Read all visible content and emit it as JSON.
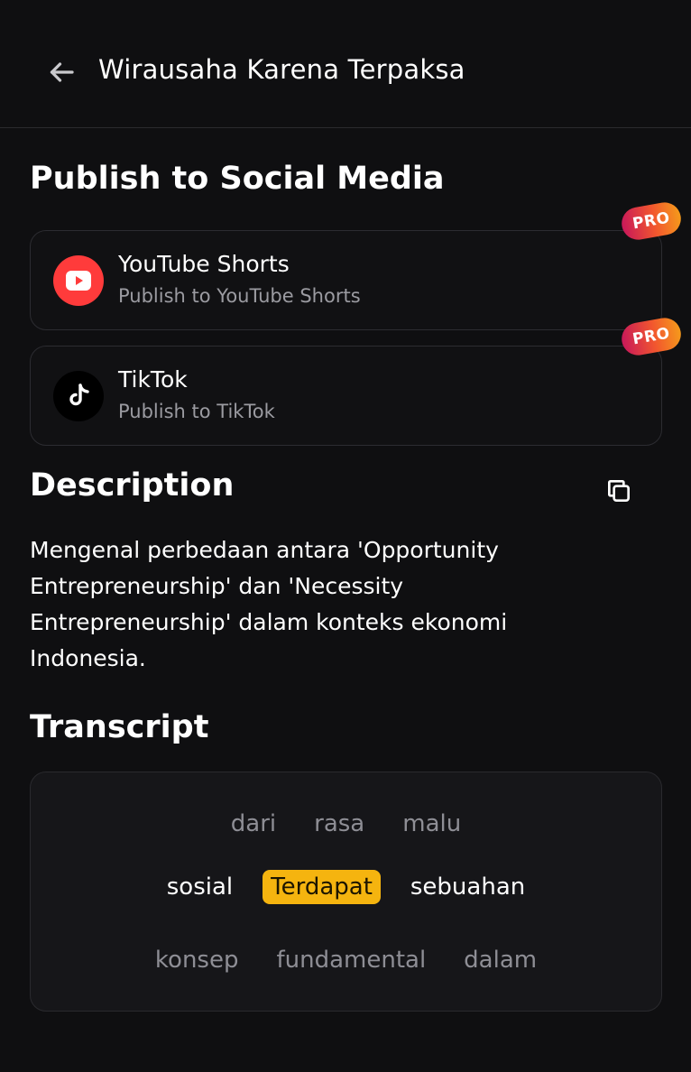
{
  "header": {
    "title": "Wirausaha Karena Terpaksa",
    "back_icon": "arrow-left-icon"
  },
  "publish": {
    "title": "Publish to Social Media",
    "platforms": [
      {
        "name": "YouTube Shorts",
        "subtitle": "Publish to YouTube Shorts",
        "badge": "PRO",
        "icon": "youtube-icon",
        "color": "#ff3b3b"
      },
      {
        "name": "TikTok",
        "subtitle": "Publish to TikTok",
        "badge": "PRO",
        "icon": "tiktok-icon",
        "color": "#000000"
      }
    ]
  },
  "description": {
    "title": "Description",
    "text": "Mengenal perbedaan antara 'Opportunity Entrepreneurship' dan 'Necessity Entrepreneurship' dalam konteks ekonomi Indonesia.",
    "copy_icon": "copy-icon"
  },
  "transcript": {
    "title": "Transcript",
    "lines": [
      [
        "dari",
        "rasa",
        "malu"
      ],
      [
        "sosial",
        "Terdapat",
        "sebuahan"
      ],
      [
        "konsep",
        "fundamental",
        "dalam"
      ]
    ],
    "active_word": "Terdapat"
  },
  "colors": {
    "background": "#0f0f11",
    "accent": "#f5b40f",
    "youtube": "#ff3b3b"
  }
}
